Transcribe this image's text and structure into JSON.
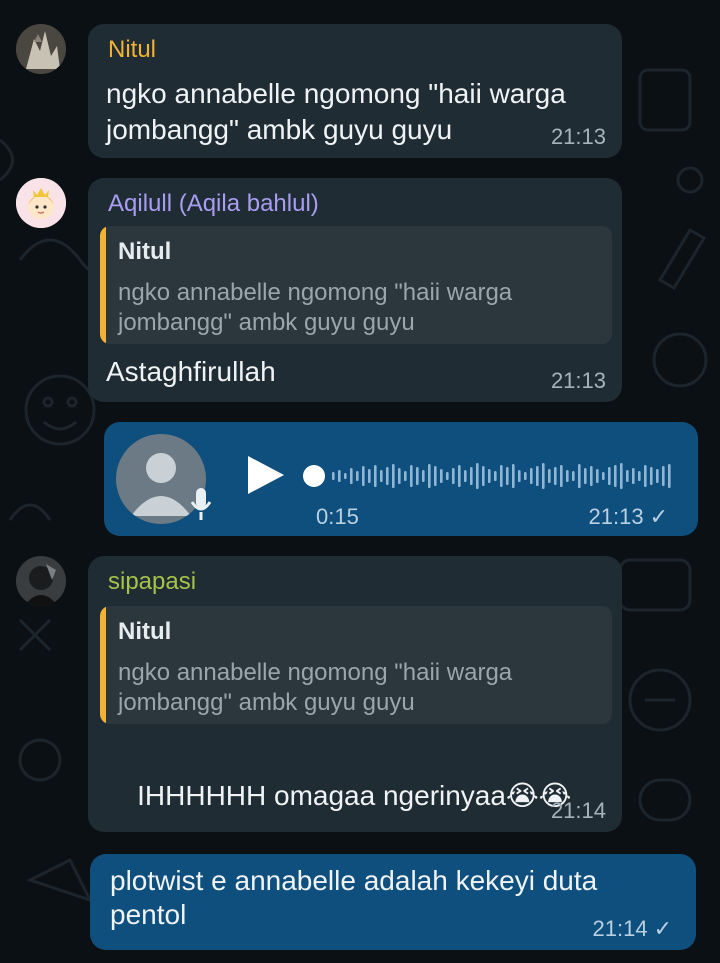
{
  "colors": {
    "background": "#0b1014",
    "incoming_bubble": "#202c33",
    "outgoing_bubble": "#0f4f7d",
    "quote_bar": "#f2b234",
    "sender_nitul": "#f2b234",
    "sender_aqilull": "#a99df2",
    "sender_sipapasi": "#a5c24a"
  },
  "messages": [
    {
      "sender": "Nitul",
      "text": "ngko annabelle ngomong \"haii warga\njombangg\" ambk guyu guyu",
      "time": "21:13"
    },
    {
      "sender": "Aqilull (Aqila bahlul)",
      "quote_sender": "Nitul",
      "quote_text": "ngko annabelle ngomong \"haii warga\njombangg\" ambk guyu guyu",
      "text": "Astaghfirullah",
      "time": "21:13"
    },
    {
      "type": "voice",
      "duration": "0:15",
      "time": "21:13",
      "status_icon": "single-check-icon"
    },
    {
      "sender": "sipapasi",
      "quote_sender": "Nitul",
      "quote_text": "ngko annabelle ngomong \"haii warga\njombangg\" ambk guyu guyu",
      "text": "IHHHHHH omagaa ngerinyaa",
      "emoji": "😭😭",
      "time": "21:14"
    },
    {
      "text": "plotwist e annabelle adalah kekeyi duta\npentol",
      "time": "21:14",
      "status_icon": "single-check-icon"
    }
  ]
}
